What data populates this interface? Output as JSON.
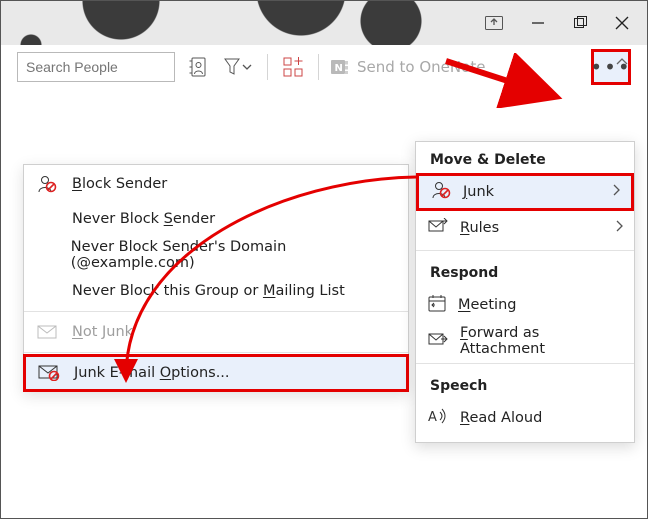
{
  "toolbar": {
    "search_placeholder": "Search People",
    "send_onenote_label": "Send to OneNote"
  },
  "left_menu": {
    "block_sender": "Block Sender",
    "never_block_sender": "Never Block Sender",
    "never_block_domain": "Never Block Sender's Domain (@example.com)",
    "never_block_group": "Never Block this Group or Mailing List",
    "not_junk": "Not Junk",
    "junk_options": "Junk E-mail Options..."
  },
  "overflow": {
    "section_move_delete": "Move & Delete",
    "junk": "Junk",
    "rules": "Rules",
    "section_respond": "Respond",
    "meeting": "Meeting",
    "forward_attachment": "Forward as Attachment",
    "section_speech": "Speech",
    "read_aloud": "Read Aloud"
  }
}
